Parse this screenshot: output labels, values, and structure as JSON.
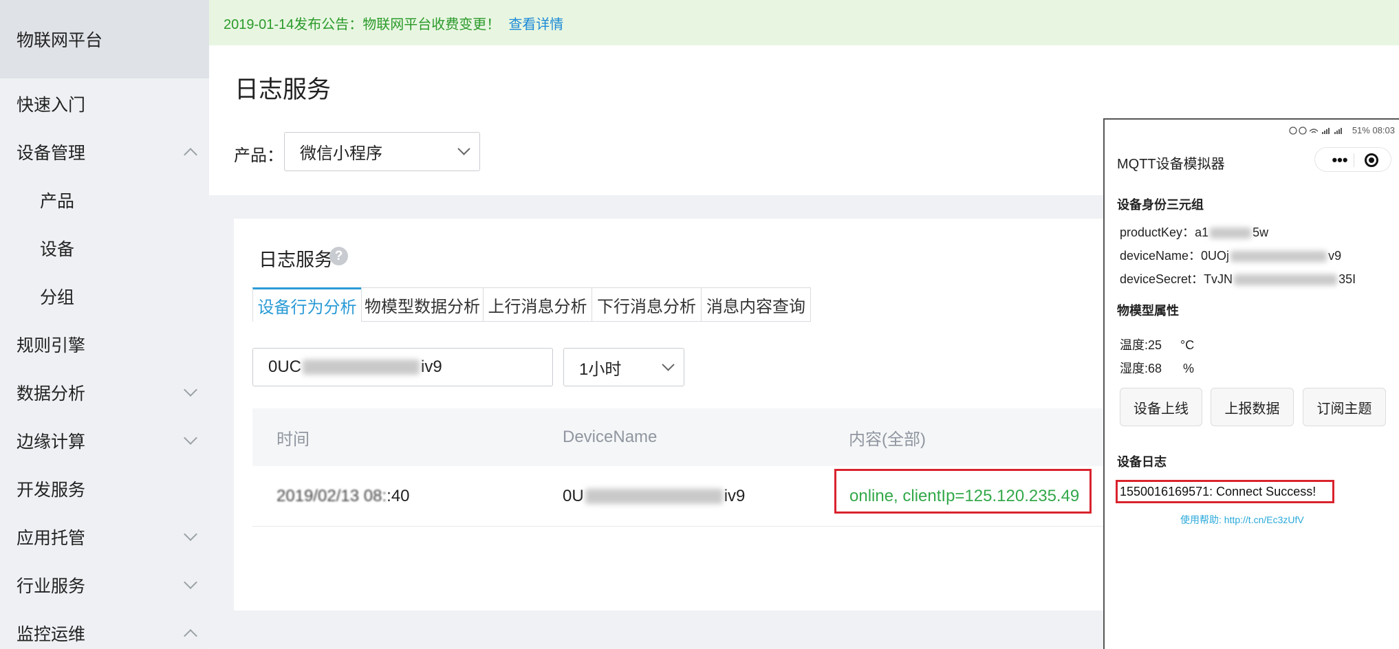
{
  "sidebar": {
    "title": "物联网平台",
    "items": [
      {
        "label": "快速入门",
        "arrow": ""
      },
      {
        "label": "设备管理",
        "arrow": "up"
      },
      {
        "label": "产品",
        "arrow": ""
      },
      {
        "label": "设备",
        "arrow": ""
      },
      {
        "label": "分组",
        "arrow": ""
      },
      {
        "label": "规则引擎",
        "arrow": ""
      },
      {
        "label": "数据分析",
        "arrow": "down"
      },
      {
        "label": "边缘计算",
        "arrow": "down"
      },
      {
        "label": "开发服务",
        "arrow": ""
      },
      {
        "label": "应用托管",
        "arrow": "down"
      },
      {
        "label": "行业服务",
        "arrow": "down"
      },
      {
        "label": "监控运维",
        "arrow": "up"
      }
    ]
  },
  "notice": {
    "text": "2019-01-14发布公告：物联网平台收费变更！",
    "link": "查看详情"
  },
  "page": {
    "title": "日志服务",
    "product_label": "产品：",
    "product_value": "微信小程序"
  },
  "card": {
    "title": "日志服务",
    "help_icon": "?",
    "tabs": [
      "设备行为分析",
      "物模型数据分析",
      "上行消息分析",
      "下行消息分析",
      "消息内容查询"
    ],
    "active_tab": 0,
    "device_input": {
      "prefix": "0UC",
      "suffix": "iv9"
    },
    "time_range": "1小时",
    "columns": [
      "时间",
      "DeviceName",
      "内容(全部)"
    ],
    "row": {
      "time_prefix": "2019/02/13 08:",
      "time_suffix": ":40",
      "device_prefix": "0U",
      "device_suffix": "iv9",
      "content": "online, clientIp=125.120.235.49"
    }
  },
  "phone": {
    "status": "51%  08:03",
    "title": "MQTT设备模拟器",
    "capsule_dots": "•••",
    "section_identity": "设备身份三元组",
    "product_key": {
      "label": "productKey：",
      "prefix": "a1",
      "suffix": "5w"
    },
    "device_name": {
      "label": "deviceName：",
      "prefix": "0UOj",
      "suffix": "v9"
    },
    "device_secret": {
      "label": "deviceSecret：",
      "prefix": "TvJN",
      "suffix": "35I"
    },
    "section_props": "物模型属性",
    "temperature": {
      "label": "温度:25",
      "unit": "°C"
    },
    "humidity": {
      "label": "湿度:68",
      "unit": "%"
    },
    "buttons": [
      "设备上线",
      "上报数据",
      "订阅主题"
    ],
    "section_log": "设备日志",
    "log_line": "1550016169571: Connect Success!",
    "help": "使用帮助: http://t.cn/Ec3zUfV"
  },
  "colors": {
    "accent": "#2b9bd6",
    "success": "#33a84a",
    "highlight": "#d9232d",
    "notice_bg": "#e8f6e1"
  }
}
